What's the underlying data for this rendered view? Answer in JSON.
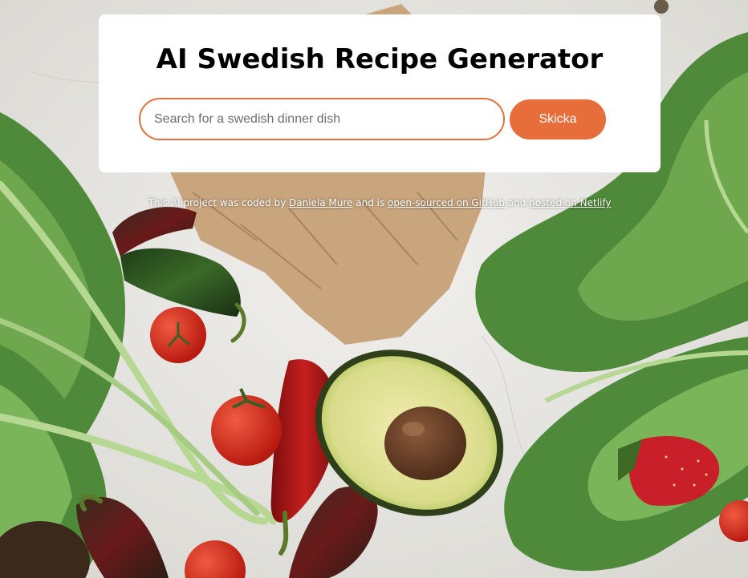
{
  "header": {
    "title": "AI Swedish Recipe Generator"
  },
  "search": {
    "placeholder": "Search for a swedish dinner dish",
    "value": ""
  },
  "submit": {
    "label": "Skicka"
  },
  "footer": {
    "text_1": "This AI project was coded by ",
    "author_link": "Daniela Mure",
    "text_2": " and is ",
    "github_link": "open-sourced on GitHub",
    "text_3": " and ",
    "netlify_link": "hosted on Netlify"
  },
  "theme": {
    "accent": "#e76d3b",
    "card_background": "#ffffff",
    "page_background": "#e9e8e4"
  },
  "background_image": {
    "subject": "vegetables-photo",
    "items": [
      "kale",
      "tomato",
      "chili-pepper",
      "avocado",
      "paper-bag",
      "strawberry"
    ]
  }
}
